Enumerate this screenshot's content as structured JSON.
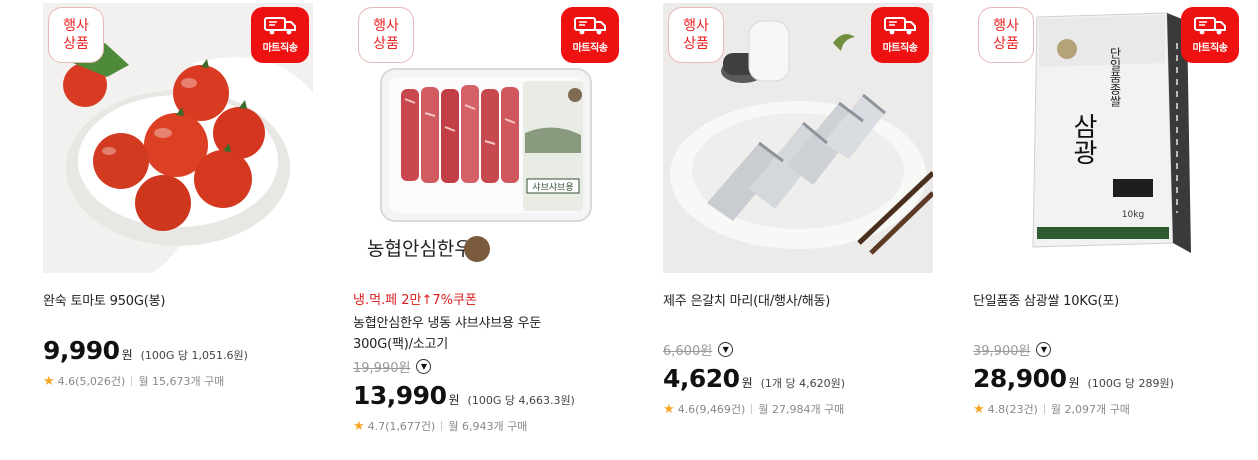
{
  "badges": {
    "event_line1": "행사",
    "event_line2": "상품",
    "mart": "마트직송",
    "truck_icon": "delivery-truck-icon"
  },
  "colors": {
    "accent": "#e11111",
    "promo": "#d91f1f",
    "star": "#f5a623"
  },
  "products": [
    {
      "promo": "",
      "name_line1": "완숙 토마토 950G(봉)",
      "name_line2": "",
      "original_price": "",
      "price": "9,990",
      "currency": "원",
      "unit_price": "(100G 당 1,051.6원)",
      "rating": "4.6(5,026건)",
      "monthly": "월 15,673개 구매"
    },
    {
      "promo": "냉.먹.페 2만↑7%쿠폰",
      "name_line1": "농협안심한우 냉동 샤브샤브용 우둔",
      "name_line2": "300G(팩)/소고기",
      "original_price": "19,990원",
      "price": "13,990",
      "currency": "원",
      "unit_price": "(100G 당 4,663.3원)",
      "rating": "4.7(1,677건)",
      "monthly": "월 6,943개 구매"
    },
    {
      "promo": "",
      "name_line1": "제주 은갈치 마리(대/행사/해동)",
      "name_line2": "",
      "original_price": "6,600원",
      "price": "4,620",
      "currency": "원",
      "unit_price": "(1개 당 4,620원)",
      "rating": "4.6(9,469건)",
      "monthly": "월 27,984개 구매"
    },
    {
      "promo": "",
      "name_line1": "단일품종 삼광쌀 10KG(포)",
      "name_line2": "",
      "original_price": "39,900원",
      "price": "28,900",
      "currency": "원",
      "unit_price": "(100G 당 289원)",
      "rating": "4.8(23건)",
      "monthly": "월 2,097개 구매"
    }
  ],
  "image_text": {
    "beef_brand": "농협안심한우",
    "beef_label": "샤브샤브용",
    "rice_brand": "삼광",
    "rice_sub": "단일품종쌀",
    "rice_weight": "10kg"
  }
}
